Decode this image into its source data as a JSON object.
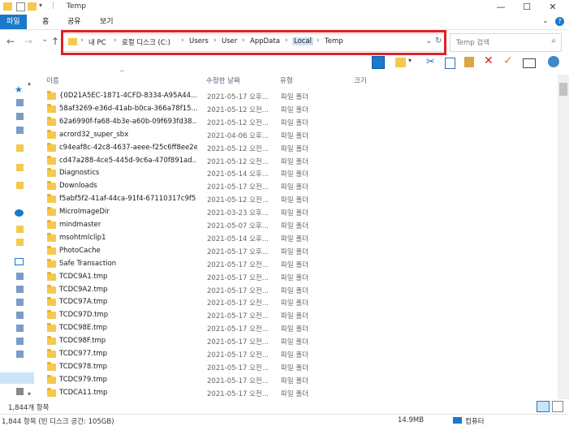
{
  "window": {
    "title": "Temp",
    "minimize": "—",
    "maximize": "☐",
    "close": "✕"
  },
  "ribbon": {
    "tabs": [
      "파일",
      "홈",
      "공유",
      "보기"
    ],
    "help": "?"
  },
  "nav": {
    "back": "←",
    "forward": "→",
    "recent": "⌄",
    "up": "↑"
  },
  "address": {
    "crumbs": [
      "내 PC",
      "로컬 디스크 (C:)",
      "Users",
      "User",
      "AppData",
      "Local",
      "Temp"
    ],
    "refresh": "↻"
  },
  "search": {
    "placeholder": "Temp 검색"
  },
  "columns": {
    "name": "이름",
    "date": "수정한 날짜",
    "type": "유형",
    "size": "크기"
  },
  "files": [
    {
      "name": "{0D21A5EC-1871-4CFD-8334-A95A44...",
      "date": "2021-05-17 오후...",
      "type": "파일 폴더"
    },
    {
      "name": "58af3269-e36d-41ab-b0ca-366a78f15...",
      "date": "2021-05-12 오전...",
      "type": "파일 폴더"
    },
    {
      "name": "62a6990f-fa68-4b3e-a60b-09f693fd38...",
      "date": "2021-05-12 오전...",
      "type": "파일 폴더"
    },
    {
      "name": "acrord32_super_sbx",
      "date": "2021-04-06 오후...",
      "type": "파일 폴더"
    },
    {
      "name": "c94eaf8c-42c8-4637-aeee-f25c6ff8ee2e",
      "date": "2021-05-12 오전...",
      "type": "파일 폴더"
    },
    {
      "name": "cd47a288-4ce5-445d-9c6a-470f891ad...",
      "date": "2021-05-12 오전...",
      "type": "파일 폴더"
    },
    {
      "name": "Diagnostics",
      "date": "2021-05-14 오후...",
      "type": "파일 폴더"
    },
    {
      "name": "Downloads",
      "date": "2021-05-17 오전...",
      "type": "파일 폴더"
    },
    {
      "name": "f5abf5f2-41af-44ca-91f4-67110317c9f5",
      "date": "2021-05-12 오전...",
      "type": "파일 폴더"
    },
    {
      "name": "MicroImageDir",
      "date": "2021-03-23 오후...",
      "type": "파일 폴더"
    },
    {
      "name": "mindmaster",
      "date": "2021-05-07 오후...",
      "type": "파일 폴더"
    },
    {
      "name": "msohtmlclip1",
      "date": "2021-05-14 오후...",
      "type": "파일 폴더"
    },
    {
      "name": "PhotoCache",
      "date": "2021-05-17 오후...",
      "type": "파일 폴더"
    },
    {
      "name": "Safe Transaction",
      "date": "2021-05-17 오전...",
      "type": "파일 폴더"
    },
    {
      "name": "TCDC9A1.tmp",
      "date": "2021-05-17 오전...",
      "type": "파일 폴더"
    },
    {
      "name": "TCDC9A2.tmp",
      "date": "2021-05-17 오전...",
      "type": "파일 폴더"
    },
    {
      "name": "TCDC97A.tmp",
      "date": "2021-05-17 오전...",
      "type": "파일 폴더"
    },
    {
      "name": "TCDC97D.tmp",
      "date": "2021-05-17 오전...",
      "type": "파일 폴더"
    },
    {
      "name": "TCDC98E.tmp",
      "date": "2021-05-17 오전...",
      "type": "파일 폴더"
    },
    {
      "name": "TCDC98F.tmp",
      "date": "2021-05-17 오전...",
      "type": "파일 폴더"
    },
    {
      "name": "TCDC977.tmp",
      "date": "2021-05-17 오전...",
      "type": "파일 폴더"
    },
    {
      "name": "TCDC978.tmp",
      "date": "2021-05-17 오전...",
      "type": "파일 폴더"
    },
    {
      "name": "TCDC979.tmp",
      "date": "2021-05-17 오전...",
      "type": "파일 폴더"
    },
    {
      "name": "TCDCA11.tmp",
      "date": "2021-05-17 오전...",
      "type": "파일 폴더"
    }
  ],
  "status": {
    "item_count": "1,844개 항목",
    "bottom_left": "1,844 항목 (빈 디스크 공간: 105GB)",
    "size": "14.9MB",
    "location": "컴퓨터"
  },
  "colors": {
    "accent": "#1979ca",
    "highlight_box": "#e0202a",
    "folder": "#f5c94d"
  }
}
